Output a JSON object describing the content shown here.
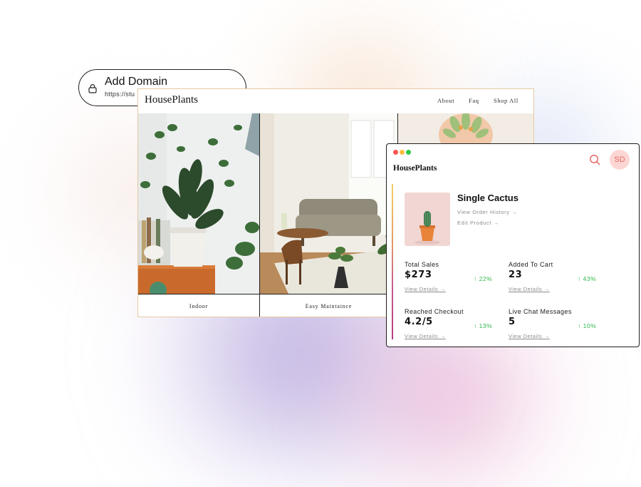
{
  "domain_pill": {
    "title": "Add Domain",
    "url_preview": "https://stu"
  },
  "storefront": {
    "logo": "HousePlants",
    "nav": [
      "About",
      "Faq",
      "Shop All"
    ],
    "panels": [
      {
        "caption": "Indoor"
      },
      {
        "caption": "Easy Maintaince"
      },
      {
        "caption": ""
      }
    ]
  },
  "dashboard": {
    "logo": "HousePlants",
    "avatar_initials": "SD",
    "product": {
      "name": "Single Cactus",
      "links": [
        "View Order History →",
        "Edit Product →"
      ]
    },
    "stats": [
      {
        "label": "Total Sales",
        "value": "$273",
        "change": "↑ 22%",
        "details": "View Details →"
      },
      {
        "label": "Added To Cart",
        "value": "23",
        "change": "↑ 43%",
        "details": "View Details →"
      },
      {
        "label": "Reached Checkout",
        "value": "4.2/5",
        "change": "↑ 13%",
        "details": "View Details →"
      },
      {
        "label": "Live Chat Messages",
        "value": "5",
        "change": "↑ 10%",
        "details": "View Details →"
      }
    ]
  },
  "icons": {
    "domain_pill": "lock-icon",
    "dashboard_search": "search-icon"
  },
  "colors": {
    "accent_change": "#2fb84c",
    "avatar_bg": "#fbd6d3",
    "avatar_text": "#e86a66",
    "search_icon": "#e86a66",
    "window_close": "#fc5753",
    "window_minimize": "#fdbc40",
    "window_maximize": "#33c748"
  }
}
